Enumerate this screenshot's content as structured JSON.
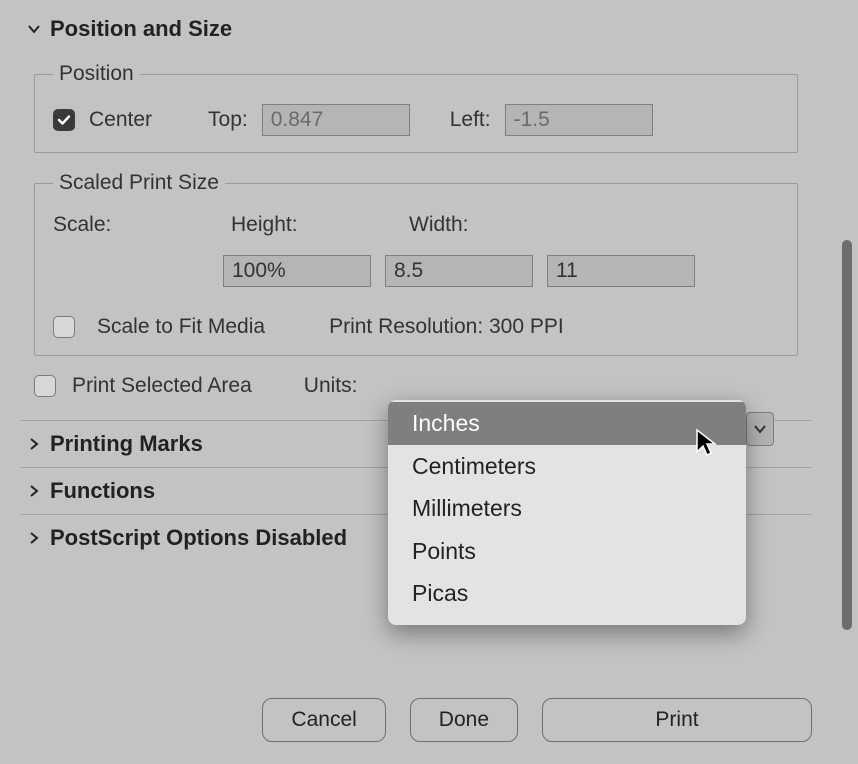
{
  "sections": {
    "position_size": {
      "title": "Position and Size",
      "expanded": true,
      "position": {
        "legend": "Position",
        "center_label": "Center",
        "center_checked": true,
        "top_label": "Top:",
        "top_value": "0.847",
        "left_label": "Left:",
        "left_value": "-1.5"
      },
      "scaled": {
        "legend": "Scaled Print Size",
        "scale_label": "Scale:",
        "scale_value": "100%",
        "height_label": "Height:",
        "height_value": "8.5",
        "width_label": "Width:",
        "width_value": "11",
        "fit_label": "Scale to Fit Media",
        "fit_checked": false,
        "resolution_label": "Print Resolution: 300 PPI"
      },
      "print_selected": {
        "label": "Print Selected Area",
        "checked": false
      },
      "units": {
        "label": "Units:",
        "selected": "Inches",
        "options": [
          "Inches",
          "Centimeters",
          "Millimeters",
          "Points",
          "Picas"
        ]
      }
    },
    "printing_marks": {
      "title": "Printing Marks",
      "expanded": false
    },
    "functions": {
      "title": "Functions",
      "expanded": false
    },
    "postscript": {
      "title": "PostScript Options Disabled",
      "expanded": false
    }
  },
  "footer": {
    "cancel": "Cancel",
    "done": "Done",
    "print": "Print"
  }
}
